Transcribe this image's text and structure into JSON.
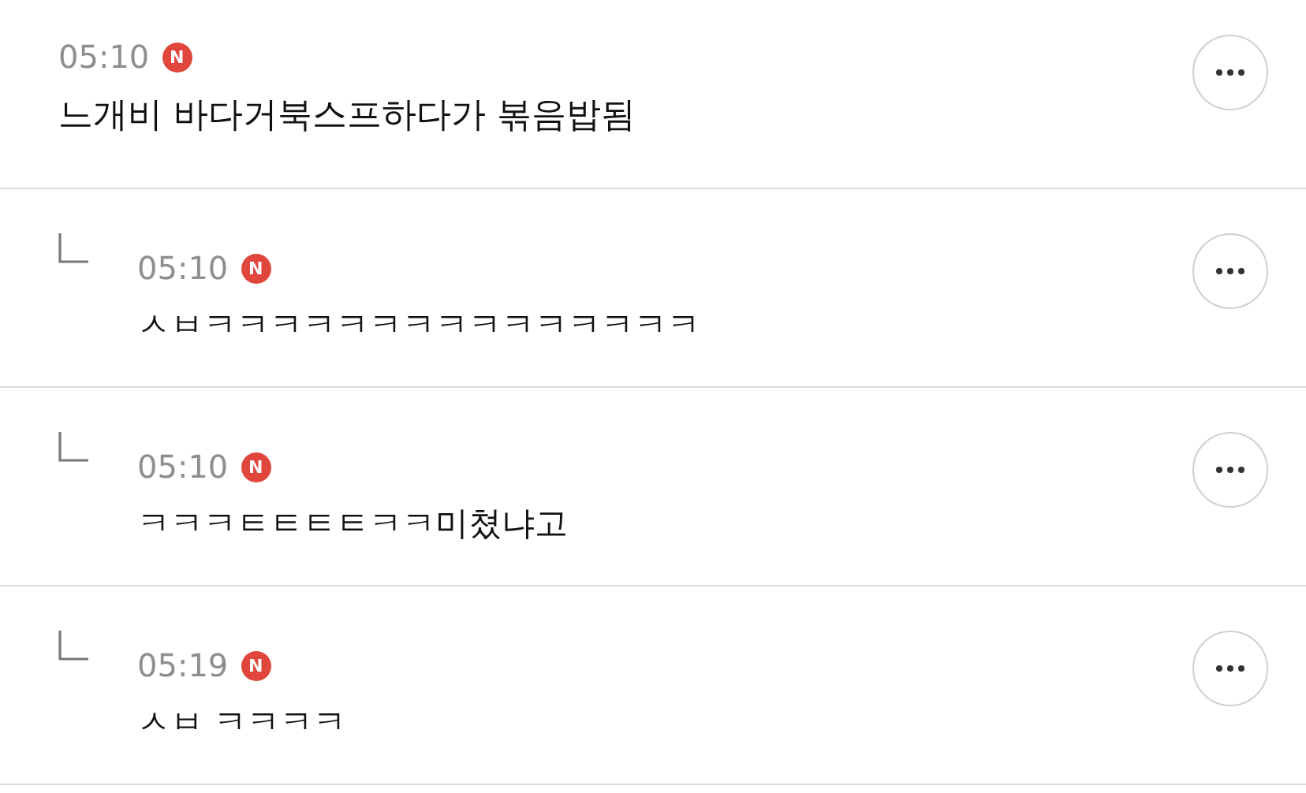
{
  "comments": [
    {
      "kind": "comment",
      "time": "05:10",
      "badge": "N",
      "text": "느개비 바다거북스프하다가 볶음밥됨"
    },
    {
      "kind": "reply",
      "time": "05:10",
      "badge": "N",
      "text": "ㅅㅂㅋㅋㅋㅋㅋㅋㅋㅋㅋㅋㅋㅋㅋㅋㅋ"
    },
    {
      "kind": "reply",
      "time": "05:10",
      "badge": "N",
      "text": "ㅋㅋㅋㅌㅌㅌㅌㅋㅋ미쳤냐고"
    },
    {
      "kind": "reply",
      "time": "05:19",
      "badge": "N",
      "text": "ㅅㅂ ㅋㅋㅋㅋ"
    }
  ]
}
